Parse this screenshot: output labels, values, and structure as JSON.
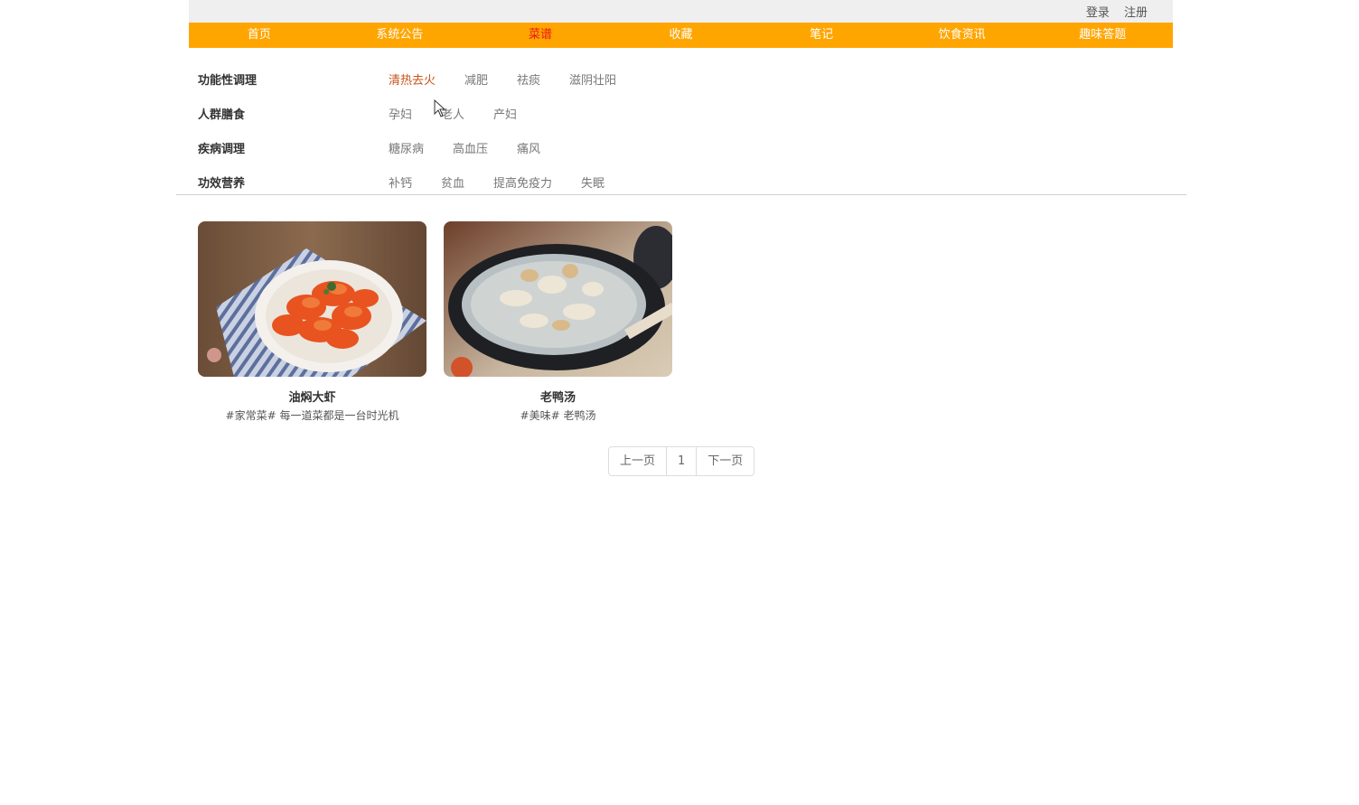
{
  "header": {
    "login_label": "登录",
    "register_label": "注册"
  },
  "nav": {
    "items": [
      {
        "label": "首页"
      },
      {
        "label": "系统公告"
      },
      {
        "label": "菜谱"
      },
      {
        "label": "收藏"
      },
      {
        "label": "笔记"
      },
      {
        "label": "饮食资讯"
      },
      {
        "label": "趣味答题"
      }
    ],
    "active_color": "#e8161c",
    "bar_color": "#ffa500"
  },
  "filters": {
    "rows": [
      {
        "label": "功能性调理",
        "options": [
          "清热去火",
          "减肥",
          "祛痰",
          "滋阴壮阳"
        ]
      },
      {
        "label": "人群膳食",
        "options": [
          "孕妇",
          "老人",
          "产妇"
        ]
      },
      {
        "label": "疾病调理",
        "options": [
          "糖尿病",
          "高血压",
          "痛风"
        ]
      },
      {
        "label": "功效营养",
        "options": [
          "补钙",
          "贫血",
          "提高免疫力",
          "失眠"
        ]
      }
    ],
    "selected_color": "#c8531a"
  },
  "recipes": [
    {
      "title": "油焖大虾",
      "desc": "#家常菜# 每一道菜都是一台时光机"
    },
    {
      "title": "老鸭汤",
      "desc": "#美味# 老鸭汤"
    }
  ],
  "pagination": {
    "prev_label": "上一页",
    "page": "1",
    "next_label": "下一页"
  }
}
